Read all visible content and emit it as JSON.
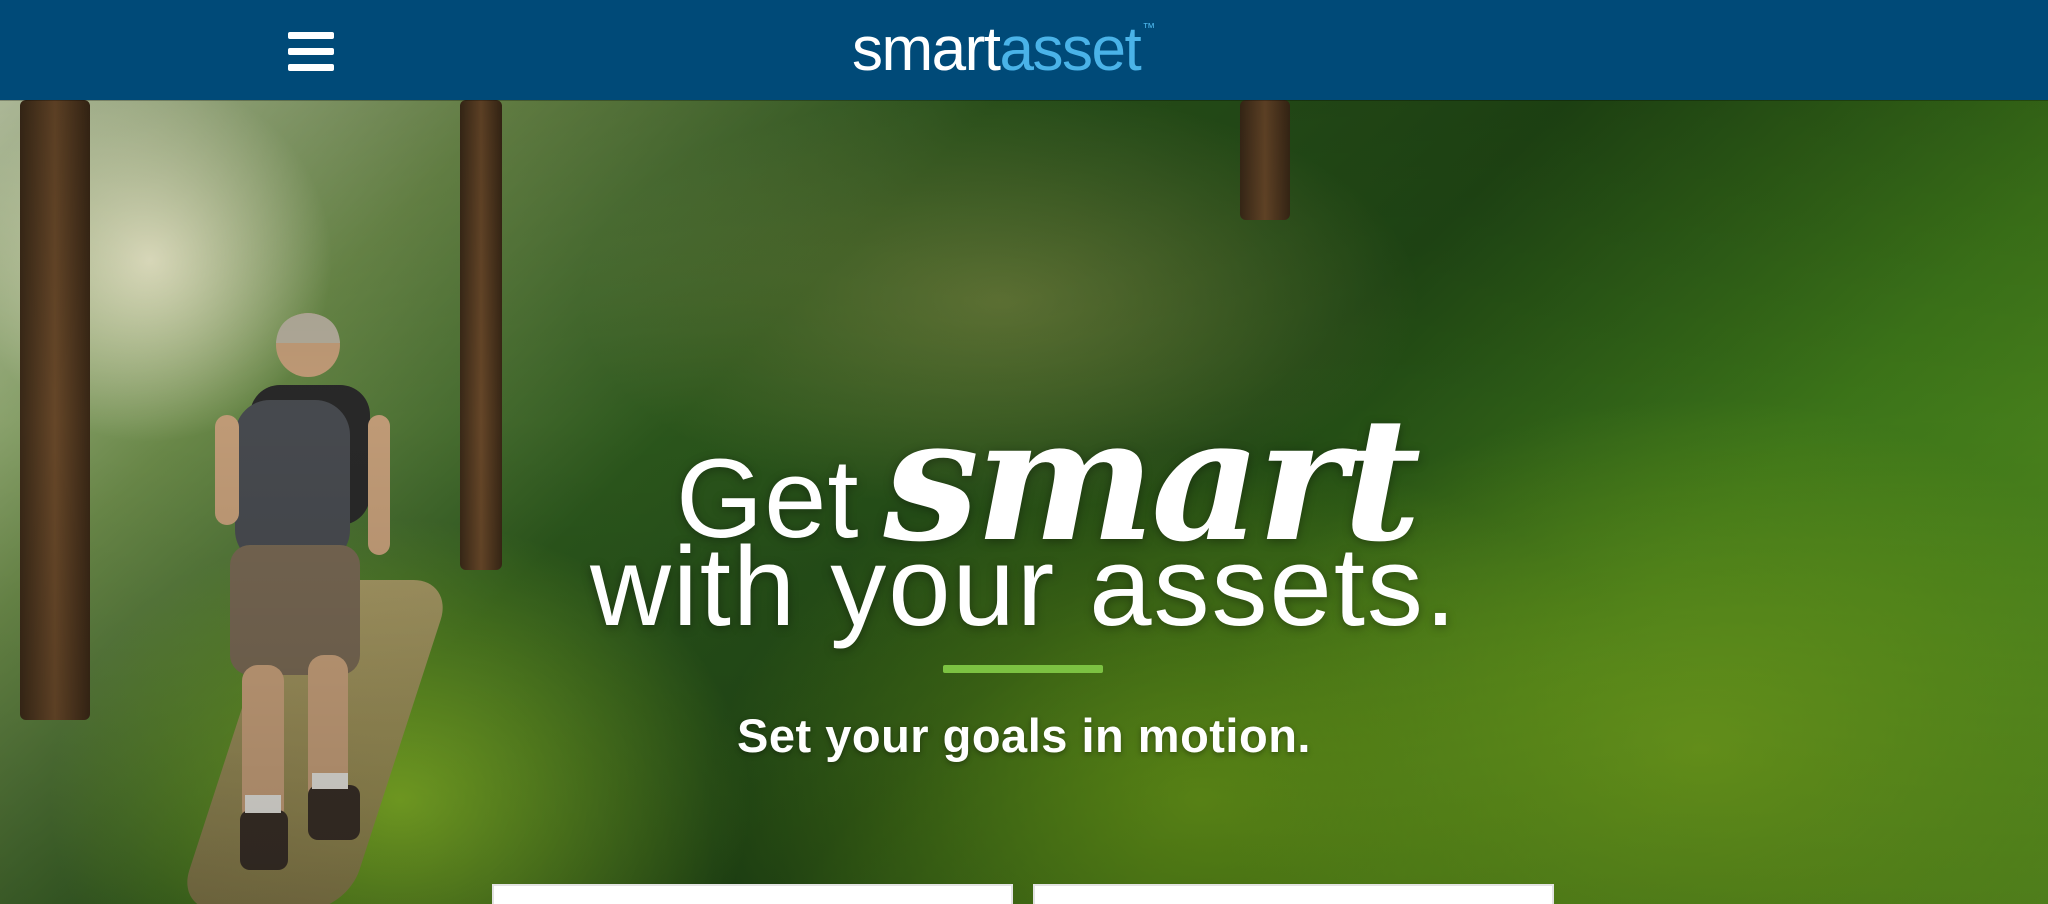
{
  "header": {
    "logo_part1": "smart",
    "logo_part2": "asset",
    "logo_tm": "™",
    "menu_icon": "hamburger-menu-icon"
  },
  "hero": {
    "headline_get": "Get",
    "headline_smart": "smart",
    "headline_line2": "with your assets.",
    "subheadline": "Set your goals in motion.",
    "accent_color": "#7cc242",
    "image_description_icon": "hiker-on-forest-trail-photo"
  },
  "cta": {
    "left_label": "",
    "right_label": ""
  },
  "colors": {
    "navbar": "#004a78",
    "logo_white": "#ffffff",
    "logo_blue": "#4ab3e8"
  }
}
